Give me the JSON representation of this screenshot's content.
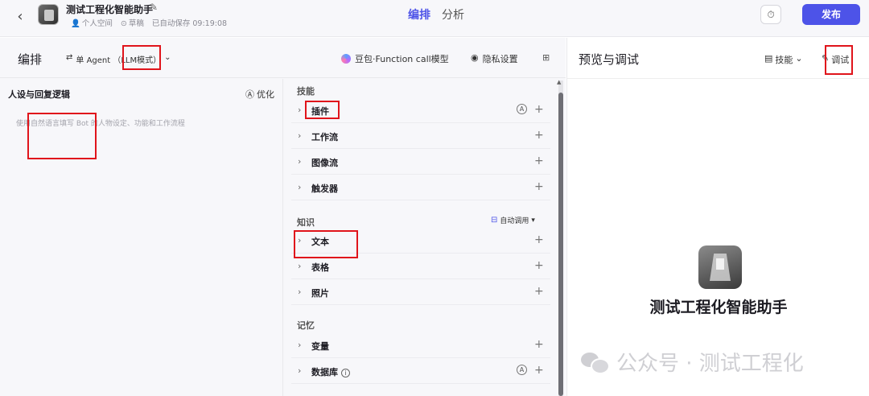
{
  "topbar": {
    "bot_name": "测试工程化智能助手",
    "space": "个人空间",
    "draft": "草稿",
    "autosave": "已自动保存 09:19:08",
    "tabs": [
      "编排",
      "分析"
    ],
    "publish": "发布"
  },
  "subbar": {
    "title": "编排",
    "agent_mode": "单 Agent （LLM模式）",
    "model": "豆包·Function call模型",
    "privacy": "隐私设置"
  },
  "persona": {
    "title": "人设与回复逻辑",
    "optimize": "优化",
    "placeholder": "使用自然语言填写 Bot 的人物设定、功能和工作流程"
  },
  "skills": {
    "section_skill": "技能",
    "skill_items": [
      "插件",
      "工作流",
      "图像流",
      "触发器"
    ],
    "section_knowledge": "知识",
    "auto_call": "自动调用",
    "knowledge_items": [
      "文本",
      "表格",
      "照片"
    ],
    "section_memory": "记忆",
    "memory_items": [
      "变量",
      "数据库"
    ]
  },
  "preview": {
    "title": "预览与调试",
    "skill_dropdown": "技能",
    "debug": "调试",
    "bot_name": "测试工程化智能助手"
  },
  "watermark": "公众号 · 测试工程化",
  "colors": {
    "accent": "#4d53e8",
    "highlight": "#e0141b"
  }
}
